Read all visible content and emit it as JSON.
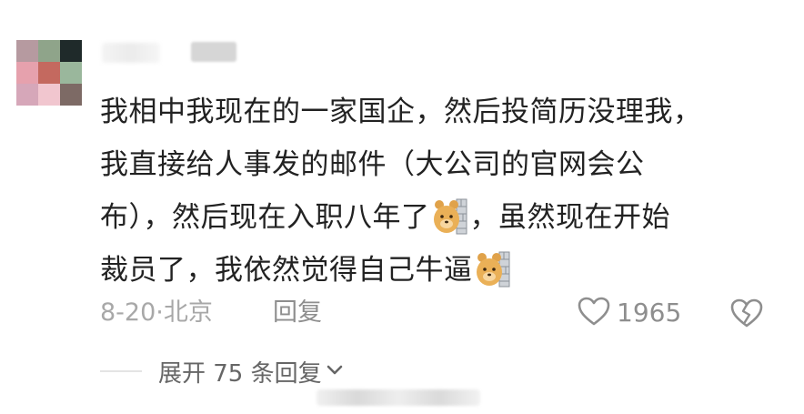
{
  "avatar": {
    "tiles": [
      "#b69aa0",
      "#8fa48a",
      "#1f2a2a",
      "#e6a1ad",
      "#c4695f",
      "#9ab79c",
      "#d6a7b9",
      "#f1c6cf",
      "#7d6a65"
    ]
  },
  "comment": {
    "lines": [
      [
        "我相中我现在的一家国企，然后投简历没理我，"
      ],
      [
        "我直接给人事发的邮件（大公司的官网会公"
      ],
      [
        "布），然后现在入职八年了",
        "",
        "，虽然现在开始"
      ],
      [
        "裁员了，我依然觉得自己牛逼",
        ""
      ]
    ],
    "emoji_name": "bear-wall-emoji"
  },
  "meta": {
    "date": "8-20",
    "separator": "·",
    "location": "北京",
    "reply_label": "回复"
  },
  "like": {
    "count": "1965"
  },
  "expand": {
    "label": "展开 75 条回复"
  },
  "colors": {
    "text": "#222222",
    "meta": "#a8a8a8",
    "icon": "#8e8e8e"
  }
}
